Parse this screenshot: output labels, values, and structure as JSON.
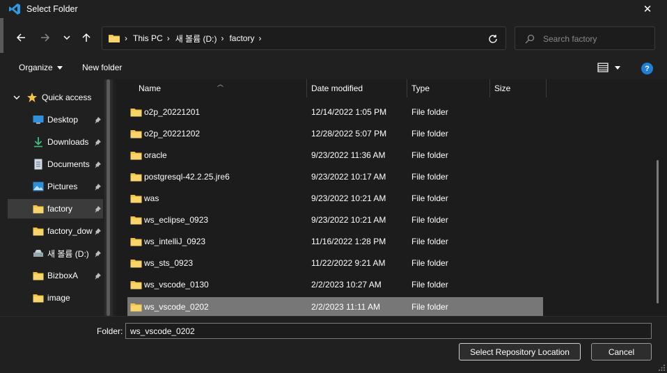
{
  "window": {
    "title": "Select Folder",
    "close_symbol": "✕"
  },
  "navigation": {
    "back_icon": "arrow-left-icon",
    "forward_icon": "arrow-right-icon",
    "recent_icon": "chevron-down-icon",
    "up_icon": "arrow-up-icon",
    "breadcrumbs": [
      "This PC",
      "새 볼륨 (D:)",
      "factory"
    ],
    "refresh_icon": "refresh-icon"
  },
  "search": {
    "placeholder": "Search factory"
  },
  "toolbar": {
    "organize_label": "Organize",
    "new_folder_label": "New folder",
    "help_symbol": "?"
  },
  "sidebar": {
    "quick_access_label": "Quick access",
    "items": [
      {
        "label": "Desktop",
        "icon": "desktop-icon",
        "pinned": true
      },
      {
        "label": "Downloads",
        "icon": "download-icon",
        "pinned": true
      },
      {
        "label": "Documents",
        "icon": "document-icon",
        "pinned": true
      },
      {
        "label": "Pictures",
        "icon": "picture-icon",
        "pinned": true
      },
      {
        "label": "factory",
        "icon": "folder-icon",
        "pinned": true,
        "selected": true
      },
      {
        "label": "factory_dow",
        "icon": "folder-icon",
        "pinned": true
      },
      {
        "label": "새 볼륨 (D:)",
        "icon": "drive-icon",
        "pinned": true
      },
      {
        "label": "BizboxA",
        "icon": "folder-icon",
        "pinned": true
      },
      {
        "label": "image",
        "icon": "folder-icon",
        "pinned": false
      }
    ]
  },
  "file_list": {
    "columns": [
      "Name",
      "Date modified",
      "Type",
      "Size"
    ],
    "rows": [
      {
        "name": "o2p_20221201",
        "date": "12/14/2022 1:05 PM",
        "type": "File folder",
        "size": ""
      },
      {
        "name": "o2p_20221202",
        "date": "12/28/2022 5:07 PM",
        "type": "File folder",
        "size": ""
      },
      {
        "name": "oracle",
        "date": "9/23/2022 11:36 AM",
        "type": "File folder",
        "size": ""
      },
      {
        "name": "postgresql-42.2.25.jre6",
        "date": "9/23/2022 10:17 AM",
        "type": "File folder",
        "size": ""
      },
      {
        "name": "was",
        "date": "9/23/2022 10:21 AM",
        "type": "File folder",
        "size": ""
      },
      {
        "name": "ws_eclipse_0923",
        "date": "9/23/2022 10:21 AM",
        "type": "File folder",
        "size": ""
      },
      {
        "name": "ws_intelliJ_0923",
        "date": "11/16/2022 1:28 PM",
        "type": "File folder",
        "size": ""
      },
      {
        "name": "ws_sts_0923",
        "date": "11/22/2022 9:21 AM",
        "type": "File folder",
        "size": ""
      },
      {
        "name": "ws_vscode_0130",
        "date": "2/2/2023 10:27 AM",
        "type": "File folder",
        "size": ""
      },
      {
        "name": "ws_vscode_0202",
        "date": "2/2/2023 11:11 AM",
        "type": "File folder",
        "size": "",
        "selected": true
      }
    ]
  },
  "footer": {
    "folder_label": "Folder:",
    "folder_value": "ws_vscode_0202",
    "select_button_label": "Select Repository Location",
    "cancel_button_label": "Cancel"
  },
  "colors": {
    "background": "#202020",
    "list_background": "#1c1c1c",
    "selected_row": "#777777",
    "folder_yellow": "#f5c342",
    "accent_blue": "#1f7fd6"
  }
}
